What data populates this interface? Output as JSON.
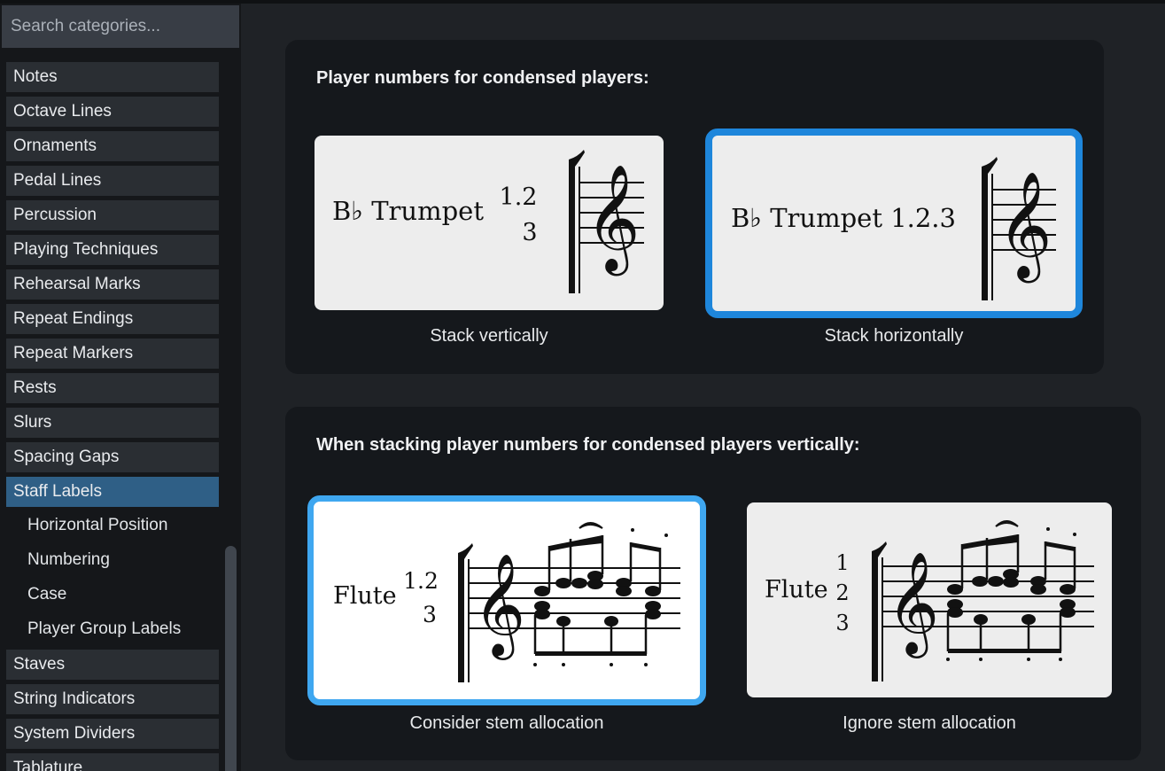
{
  "sidebar": {
    "search_placeholder": "Search categories...",
    "items": [
      {
        "label": "Notes"
      },
      {
        "label": "Octave Lines"
      },
      {
        "label": "Ornaments"
      },
      {
        "label": "Pedal Lines"
      },
      {
        "label": "Percussion"
      },
      {
        "label": "Playing Techniques"
      },
      {
        "label": "Rehearsal Marks"
      },
      {
        "label": "Repeat Endings"
      },
      {
        "label": "Repeat Markers"
      },
      {
        "label": "Rests"
      },
      {
        "label": "Slurs"
      },
      {
        "label": "Spacing Gaps"
      },
      {
        "label": "Staff Labels"
      }
    ],
    "subitems": [
      {
        "label": "Horizontal Position"
      },
      {
        "label": "Numbering"
      },
      {
        "label": "Case"
      },
      {
        "label": "Player Group Labels"
      }
    ],
    "items_after": [
      {
        "label": "Staves"
      },
      {
        "label": "String Indicators"
      },
      {
        "label": "System Dividers"
      },
      {
        "label": "Tablature"
      }
    ]
  },
  "section1": {
    "title": "Player numbers for condensed players:",
    "options": [
      {
        "caption": "Stack vertically",
        "selected": false,
        "name": "B♭ Trumpet",
        "num_line1": "1.2",
        "num_line2": "3"
      },
      {
        "caption": "Stack horizontally",
        "selected": true,
        "name": "B♭ Trumpet 1.2.3"
      }
    ]
  },
  "section2": {
    "title": "When stacking player numbers for condensed players vertically:",
    "options": [
      {
        "caption": "Consider stem allocation",
        "selected": true,
        "name": "Flute",
        "num_line1": "1.2",
        "num_line2": "3"
      },
      {
        "caption": "Ignore stem allocation",
        "selected": false,
        "name": "Flute",
        "num_line1": "1",
        "num_line2": "2",
        "num_line3": "3"
      }
    ]
  },
  "colors": {
    "accent": "#1e86db",
    "accent_light": "#3fa7f0",
    "active_item": "#2f5f86"
  }
}
